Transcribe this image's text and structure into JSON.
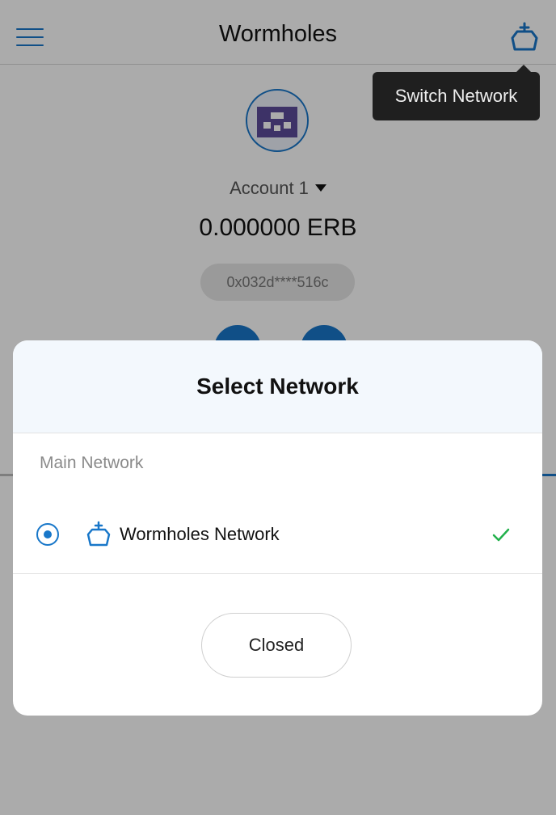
{
  "header": {
    "title": "Wormholes",
    "menu_icon": "hamburger-menu-icon",
    "network_icon": "network-crown-icon"
  },
  "tooltip": {
    "text": "Switch Network"
  },
  "account": {
    "name": "Account 1",
    "balance": "0.000000 ERB",
    "address": "0x032d****516c"
  },
  "modal": {
    "title": "Select Network",
    "section_label": "Main Network",
    "networks": [
      {
        "name": "Wormholes Network",
        "selected": true
      }
    ],
    "close_label": "Closed"
  },
  "colors": {
    "accent": "#1877c9",
    "check": "#22b14c",
    "tooltip_bg": "#1f1f1f",
    "avatar_purple": "#5b4b9a"
  }
}
